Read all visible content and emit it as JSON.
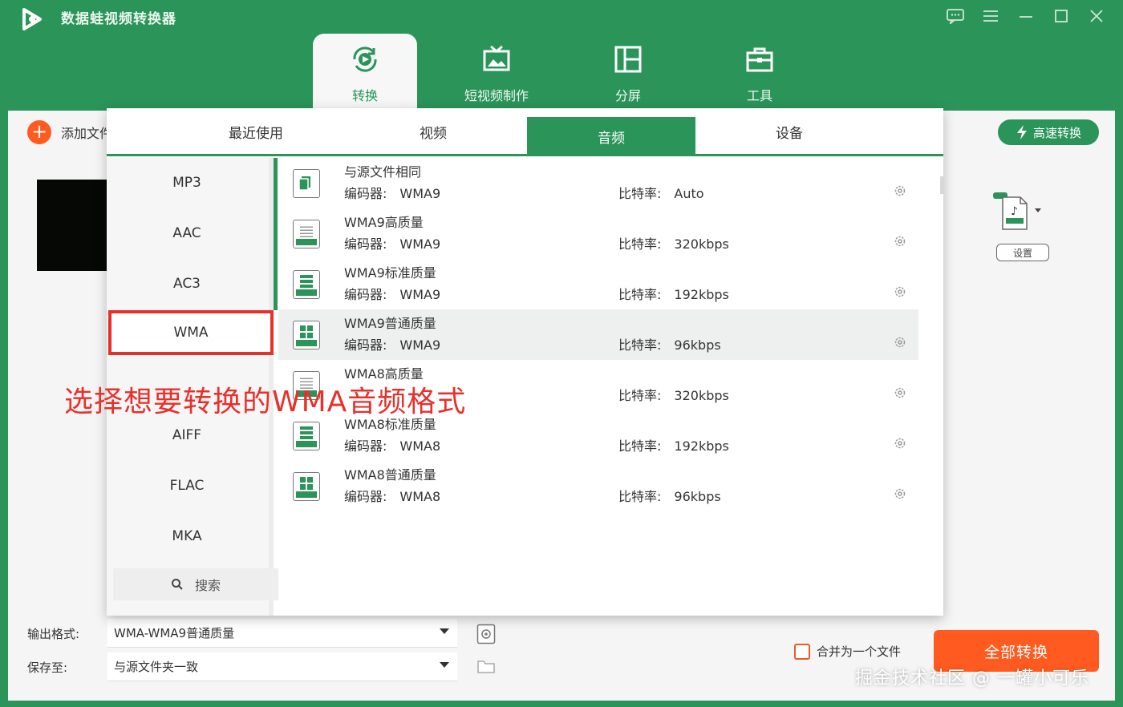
{
  "app": {
    "title": "数据蛙视频转换器"
  },
  "nav": {
    "tabs": [
      {
        "label": "转换",
        "icon": "convert-icon",
        "active": true
      },
      {
        "label": "短视频制作",
        "icon": "tv-icon",
        "active": false
      },
      {
        "label": "分屏",
        "icon": "split-screen-icon",
        "active": false
      },
      {
        "label": "工具",
        "icon": "toolbox-icon",
        "active": false
      }
    ]
  },
  "toolbar": {
    "add_file": "添加文件",
    "fast_convert": "高速转换",
    "settings": "设置"
  },
  "popup": {
    "tabs": [
      {
        "label": "最近使用",
        "active": false
      },
      {
        "label": "视频",
        "active": false
      },
      {
        "label": "音频",
        "active": true
      },
      {
        "label": "设备",
        "active": false
      }
    ],
    "formats": [
      {
        "label": "MP3",
        "selected": false
      },
      {
        "label": "AAC",
        "selected": false
      },
      {
        "label": "AC3",
        "selected": false
      },
      {
        "label": "WMA",
        "selected": true
      },
      {
        "label": "",
        "selected": false
      },
      {
        "label": "AIFF",
        "selected": false
      },
      {
        "label": "FLAC",
        "selected": false
      },
      {
        "label": "MKA",
        "selected": false
      }
    ],
    "search_label": "搜索",
    "codec_label": "编码器:",
    "bitrate_label": "比特率:",
    "presets": [
      {
        "name": "与源文件相同",
        "codec": "WMA9",
        "bitrate": "Auto",
        "highlight": false
      },
      {
        "name": "WMA9高质量",
        "codec": "WMA9",
        "bitrate": "320kbps",
        "highlight": false
      },
      {
        "name": "WMA9标准质量",
        "codec": "WMA9",
        "bitrate": "192kbps",
        "highlight": false
      },
      {
        "name": "WMA9普通质量",
        "codec": "WMA9",
        "bitrate": "96kbps",
        "highlight": true
      },
      {
        "name": "WMA8高质量",
        "codec": "WMA8",
        "bitrate": "320kbps",
        "highlight": false
      },
      {
        "name": "WMA8标准质量",
        "codec": "WMA8",
        "bitrate": "192kbps",
        "highlight": false
      },
      {
        "name": "WMA8普通质量",
        "codec": "WMA8",
        "bitrate": "96kbps",
        "highlight": false
      }
    ]
  },
  "annotation": "选择想要转换的WMA音频格式",
  "bottom": {
    "output_label": "输出格式:",
    "output_value": "WMA-WMA9普通质量",
    "save_label": "保存至:",
    "save_value": "与源文件夹一致",
    "merge_label": "合并为一个文件",
    "convert_all": "全部转换"
  },
  "watermark": "掘金技术社区 @ 一罐小可乐",
  "colors": {
    "primary": "#2a9459",
    "accent": "#ff5a1f",
    "highlight": "#e8302b"
  }
}
